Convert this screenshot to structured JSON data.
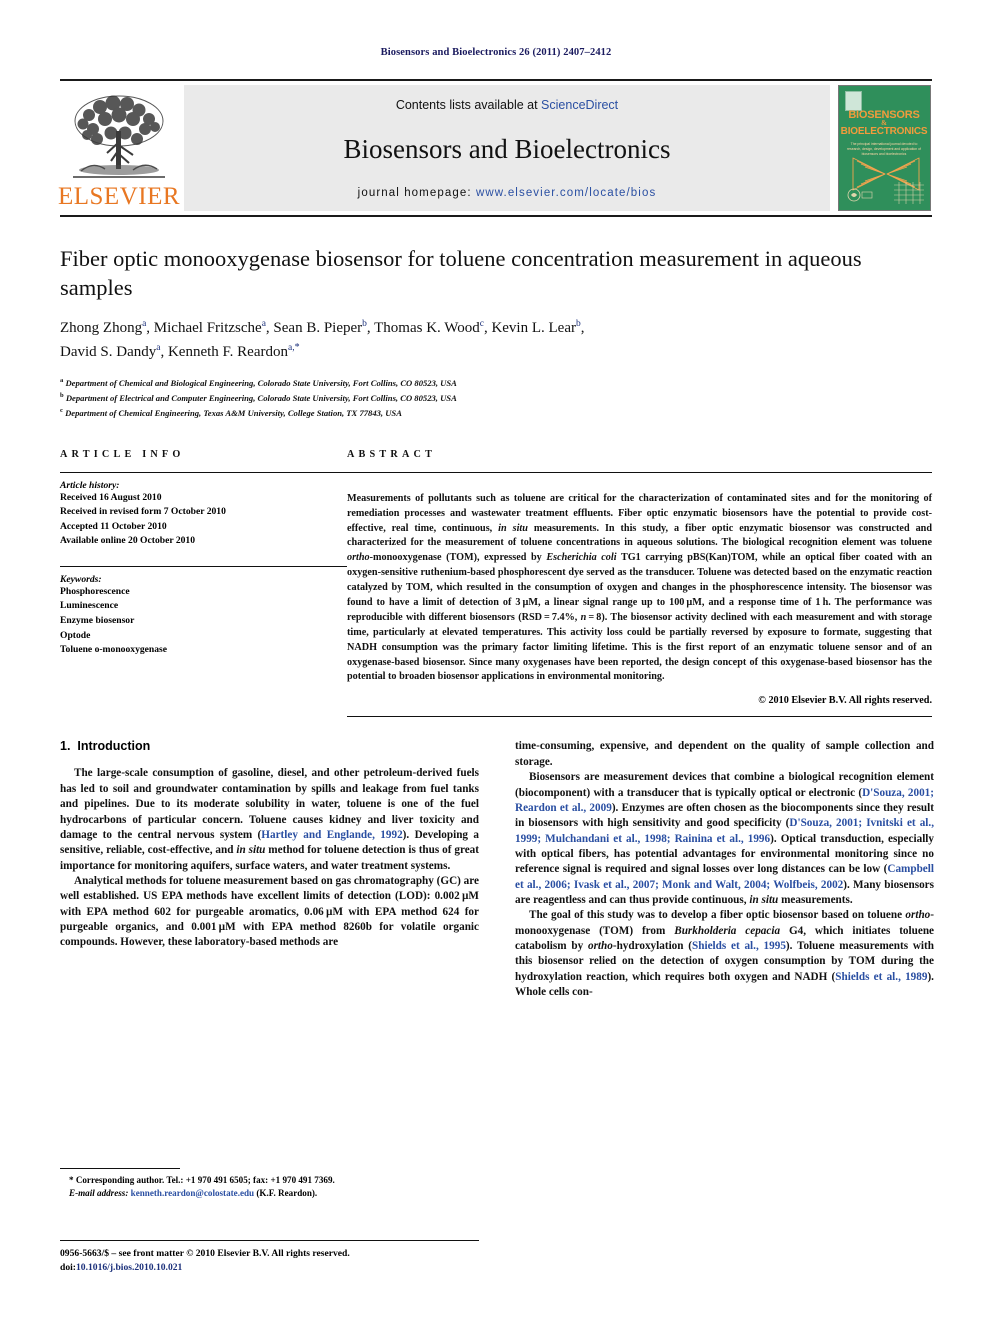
{
  "running_head": "Biosensors and Bioelectronics 26 (2011) 2407–2412",
  "masthead": {
    "publisher_wordmark": "ELSEVIER",
    "contents_prefix": "Contents lists available at ",
    "contents_link": "ScienceDirect",
    "journal_title": "Biosensors and Bioelectronics",
    "homepage_prefix": "journal homepage: ",
    "homepage_url": "www.elsevier.com/locate/bios",
    "cover": {
      "line1": "BIOSENSORS",
      "amp": "&",
      "line2": "BIOELECTRONICS",
      "subtitle": "The principal international journal devoted to research, design, development and application of biosensors and bioelectronics"
    }
  },
  "article": {
    "title": "Fiber optic monooxygenase biosensor for toluene concentration measurement in aqueous samples",
    "authors": [
      {
        "name": "Zhong Zhong",
        "sup": "a"
      },
      {
        "name": "Michael Fritzsche",
        "sup": "a"
      },
      {
        "name": "Sean B. Pieper",
        "sup": "b"
      },
      {
        "name": "Thomas K. Wood",
        "sup": "c"
      },
      {
        "name": "Kevin L. Lear",
        "sup": "b"
      },
      {
        "name": "David S. Dandy",
        "sup": "a"
      },
      {
        "name": "Kenneth F. Reardon",
        "sup": "a,*"
      }
    ],
    "affiliations": [
      {
        "sup": "a",
        "text": "Department of Chemical and Biological Engineering, Colorado State University, Fort Collins, CO 80523, USA"
      },
      {
        "sup": "b",
        "text": "Department of Electrical and Computer Engineering, Colorado State University, Fort Collins, CO 80523, USA"
      },
      {
        "sup": "c",
        "text": "Department of Chemical Engineering, Texas A&M University, College Station, TX 77843, USA"
      }
    ]
  },
  "article_info": {
    "heading": "ARTICLE INFO",
    "history_label": "Article history:",
    "history": [
      "Received 16 August 2010",
      "Received in revised form 7 October 2010",
      "Accepted 11 October 2010",
      "Available online 20 October 2010"
    ],
    "keywords_label": "Keywords:",
    "keywords": [
      "Phosphorescence",
      "Luminescence",
      "Enzyme biosensor",
      "Optode",
      "Toluene o-monooxygenase"
    ]
  },
  "abstract": {
    "heading": "ABSTRACT",
    "paragraphs": [
      "Measurements of pollutants such as toluene are critical for the characterization of contaminated sites and for the monitoring of remediation processes and wastewater treatment effluents. Fiber optic enzymatic biosensors have the potential to provide cost-effective, real time, continuous, in situ measurements. In this study, a fiber optic enzymatic biosensor was constructed and characterized for the measurement of toluene concentrations in aqueous solutions. The biological recognition element was toluene ortho-monooxygenase (TOM), expressed by Escherichia coli TG1 carrying pBS(Kan)TOM, while an optical fiber coated with an oxygen-sensitive ruthenium-based phosphorescent dye served as the transducer. Toluene was detected based on the enzymatic reaction catalyzed by TOM, which resulted in the consumption of oxygen and changes in the phosphorescence intensity. The biosensor was found to have a limit of detection of 3 µM, a linear signal range up to 100 µM, and a response time of 1 h. The performance was reproducible with different biosensors (RSD = 7.4%, n = 8). The biosensor activity declined with each measurement and with storage time, particularly at elevated temperatures. This activity loss could be partially reversed by exposure to formate, suggesting that NADH consumption was the primary factor limiting lifetime. This is the first report of an enzymatic toluene sensor and of an oxygenase-based biosensor. Since many oxygenases have been reported, the design concept of this oxygenase-based biosensor has the potential to broaden biosensor applications in environmental monitoring."
    ],
    "copyright": "© 2010 Elsevier B.V. All rights reserved."
  },
  "body": {
    "section_number": "1.",
    "section_title": "Introduction",
    "left_paragraphs": [
      "The large-scale consumption of gasoline, diesel, and other petroleum-derived fuels has led to soil and groundwater contamination by spills and leakage from fuel tanks and pipelines. Due to its moderate solubility in water, toluene is one of the fuel hydrocarbons of particular concern. Toluene causes kidney and liver toxicity and damage to the central nervous system (Hartley and Englande, 1992). Developing a sensitive, reliable, cost-effective, and in situ method for toluene detection is thus of great importance for monitoring aquifers, surface waters, and water treatment systems.",
      "Analytical methods for toluene measurement based on gas chromatography (GC) are well established. US EPA methods have excellent limits of detection (LOD): 0.002 µM with EPA method 602 for purgeable aromatics, 0.06 µM with EPA method 624 for purgeable organics, and 0.001 µM with EPA method 8260b for volatile organic compounds. However, these laboratory-based methods are"
    ],
    "right_paragraphs": [
      "time-consuming, expensive, and dependent on the quality of sample collection and storage.",
      "Biosensors are measurement devices that combine a biological recognition element (biocomponent) with a transducer that is typically optical or electronic (D'Souza, 2001; Reardon et al., 2009). Enzymes are often chosen as the biocomponents since they result in biosensors with high sensitivity and good specificity (D'Souza, 2001; Ivnitski et al., 1999; Mulchandani et al., 1998; Rainina et al., 1996). Optical transduction, especially with optical fibers, has potential advantages for environmental monitoring since no reference signal is required and signal losses over long distances can be low (Campbell et al., 2006; Ivask et al., 2007; Monk and Walt, 2004; Wolfbeis, 2002). Many biosensors are reagentless and can thus provide continuous, in situ measurements.",
      "The goal of this study was to develop a fiber optic biosensor based on toluene ortho-monooxygenase (TOM) from Burkholderia cepacia G4, which initiates toluene catabolism by ortho-hydroxylation (Shields et al., 1995). Toluene measurements with this biosensor relied on the detection of oxygen consumption by TOM during the hydroxylation reaction, which requires both oxygen and NADH (Shields et al., 1989). Whole cells con-"
    ]
  },
  "footnote": {
    "line1": "* Corresponding author. Tel.: +1 970 491 6505; fax: +1 970 491 7369.",
    "email_label": "E-mail address: ",
    "email": "kenneth.reardon@colostate.edu",
    "email_suffix": " (K.F. Reardon)."
  },
  "footer": {
    "line1": "0956-5663/$ – see front matter © 2010 Elsevier B.V. All rights reserved.",
    "doi_label": "doi:",
    "doi": "10.1016/j.bios.2010.10.021"
  },
  "colors": {
    "link": "#2a4fa2",
    "runhead": "#1a1a5e",
    "elsevier_orange": "#E87722",
    "cover_green": "#2f8f5b"
  }
}
